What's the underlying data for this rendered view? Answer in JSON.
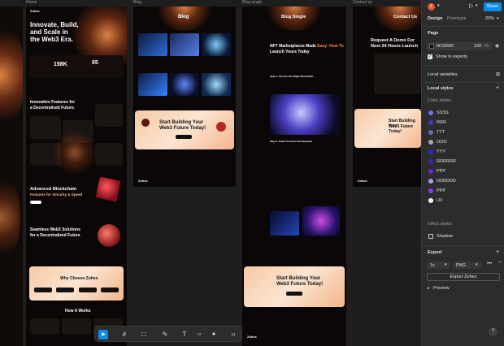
{
  "frames": {
    "home_label": "Home",
    "blog_label": "Blog",
    "blog_single_label": "Blog single",
    "contact_label": "Contact us"
  },
  "home": {
    "logo": "Zohex",
    "hero_title_1": "Innovate, Build,",
    "hero_title_2": "and Scale in",
    "hero_title_3": "the Web3 Era.",
    "stat_1": "198K",
    "stat_2": "65",
    "features_title_1": "Innovative Features for",
    "features_title_2": "a Decentralized Future.",
    "advanced_title_1": "Advanced Blockchain",
    "advanced_title_2": "Features for Security & Speed",
    "seamless_title_1": "Seamless Web3 Solutions",
    "seamless_title_2": "for a Decentralized Future",
    "why_title": "Why Choose Zohex",
    "how_title": "How It Works"
  },
  "blog": {
    "header_title": "Blog",
    "cta_title_1": "Start Building Your",
    "cta_title_2": "Web3 Future Today!",
    "logo": "Zohex"
  },
  "blog_single": {
    "header_title": "Blog Single",
    "post_title_1": "NFT Marketplaces Made",
    "post_title_accent": "Easy: How To",
    "post_title_2": "Launch Yours Today",
    "step_1": "Step 1: Choose The Right Blockchain",
    "step_2": "Step 2: Smart Contract Development",
    "cta_title_1": "Start Building Your",
    "cta_title_2": "Web3 Future Today!",
    "logo": "Zohex"
  },
  "contact": {
    "header_title": "Contact Us",
    "form_title_1": "Request A Demo For",
    "form_title_2": "Next 24 Hours Launch",
    "cta_title_1": "Start Building Your",
    "cta_title_2": "Web3 Future Today!",
    "logo": "Zohex"
  },
  "topbar": {
    "avatar_letter": "Z",
    "share_label": "Share",
    "tab_design": "Design",
    "tab_prototype": "Prototype",
    "zoom": "20%"
  },
  "page_section": {
    "title": "Page",
    "fill_hex": "0C0D0D",
    "fill_opacity": "100",
    "opacity_unit": "%",
    "show_in_exports": "Show in exports"
  },
  "local_variables": "Local variables",
  "local_styles": {
    "title": "Local styles",
    "color_styles_title": "Color styles",
    "colors": [
      {
        "name": "SSSS",
        "color": "#6d6dff"
      },
      {
        "name": "RRR",
        "color": "#3b3bb8"
      },
      {
        "name": "TTT",
        "color": "#5b6fb0"
      },
      {
        "name": "OOO",
        "color": "#9fa6c9"
      },
      {
        "name": "YYY",
        "color": "#2a2ad4"
      },
      {
        "name": "RRRRRR",
        "color": "#4b1ca8"
      },
      {
        "name": "PPP",
        "color": "#6a29d6"
      },
      {
        "name": "DDDDDD",
        "color": "#a99cf2"
      },
      {
        "name": "PPP",
        "color": "#8a38f5"
      },
      {
        "name": "UII",
        "color": "#ffffff"
      }
    ],
    "effect_styles_title": "Effect styles",
    "effects": [
      {
        "name": "Shadow"
      }
    ]
  },
  "export": {
    "title": "Export",
    "scale": "1x",
    "format": "PNG",
    "button_label": "Export Zohex",
    "preview_label": "Preview"
  },
  "help_label": "?"
}
